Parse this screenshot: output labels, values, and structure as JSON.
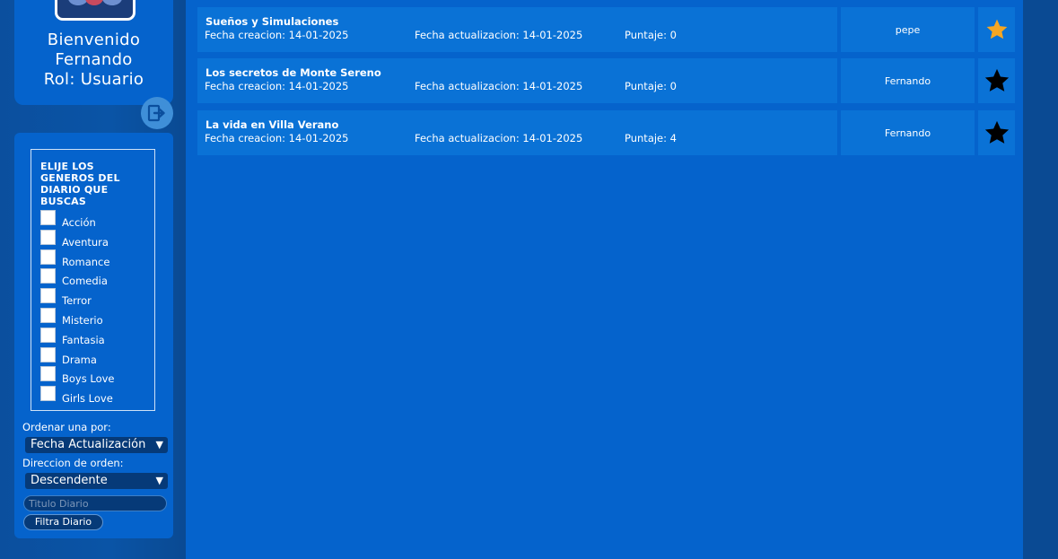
{
  "user": {
    "welcome": "Bienvenido",
    "name": "Fernando",
    "role": "Rol: Usuario"
  },
  "filter": {
    "genre_title": "ELIJE LOS GENEROS DEL DIARIO QUE BUSCAS",
    "genres": [
      "Acción",
      "Aventura",
      "Romance",
      "Comedia",
      "Terror",
      "Misterio",
      "Fantasia",
      "Drama",
      "Boys Love",
      "Girls Love"
    ],
    "sort_label": "Ordenar una por:",
    "sort_value": "Fecha Actualización",
    "direction_label": "Direccion de orden:",
    "direction_value": "Descendente",
    "search_placeholder": "Titulo Diario",
    "filter_button": "Filtra Diario"
  },
  "diaries": [
    {
      "title": "Sueños y Simulaciones",
      "created": "Fecha creacion: 14-01-2025",
      "updated": "Fecha actualizacion: 14-01-2025",
      "score": "Puntaje: 0",
      "author": "pepe",
      "favorite": true
    },
    {
      "title": "Los secretos de Monte Sereno",
      "created": "Fecha creacion: 14-01-2025",
      "updated": "Fecha actualizacion: 14-01-2025",
      "score": "Puntaje: 0",
      "author": "Fernando",
      "favorite": false
    },
    {
      "title": "La vida en Villa Verano",
      "created": "Fecha creacion: 14-01-2025",
      "updated": "Fecha actualizacion: 14-01-2025",
      "score": "Puntaje: 4",
      "author": "Fernando",
      "favorite": false
    }
  ],
  "colors": {
    "star_active": "#f5a623",
    "star_inactive": "#000000"
  }
}
